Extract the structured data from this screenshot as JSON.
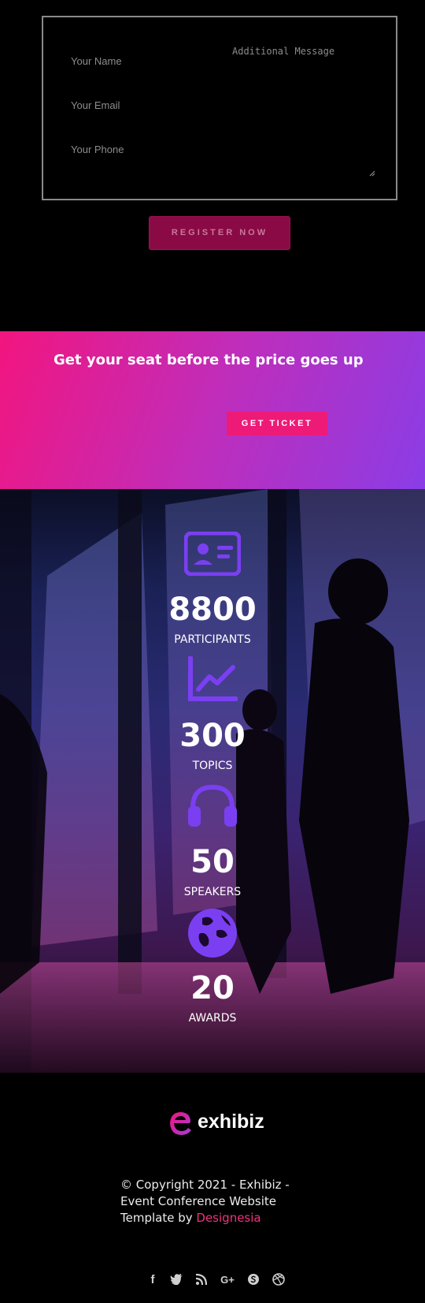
{
  "form": {
    "name_placeholder": "Your Name",
    "email_placeholder": "Your Email",
    "phone_placeholder": "Your Phone",
    "message_placeholder": "Additional Message",
    "submit_label": "REGISTER NOW"
  },
  "banner": {
    "heading": "Get your seat before the price goes up",
    "button_label": "GET TICKET"
  },
  "stats": {
    "items": [
      {
        "value": "8800",
        "label": "PARTICIPANTS",
        "icon": "id-card-icon"
      },
      {
        "value": "300",
        "label": "TOPICS",
        "icon": "line-chart-icon"
      },
      {
        "value": "50",
        "label": "SPEAKERS",
        "icon": "headphones-icon"
      },
      {
        "value": "20",
        "label": "AWARDS",
        "icon": "globe-icon"
      }
    ],
    "icon_color": "#7b3ff2"
  },
  "footer": {
    "logo_text": "exhibiz",
    "copyright_prefix": "© Copyright 2021 - Exhibiz - Event Conference Website Template by",
    "copyright_link": "Designesia",
    "social": [
      "facebook-icon",
      "twitter-icon",
      "rss-icon",
      "google-plus-icon",
      "skype-icon",
      "dribbble-icon"
    ]
  },
  "colors": {
    "accent": "#ee1a78",
    "purple": "#8a3de6",
    "register_bg": "#8a0a45"
  }
}
